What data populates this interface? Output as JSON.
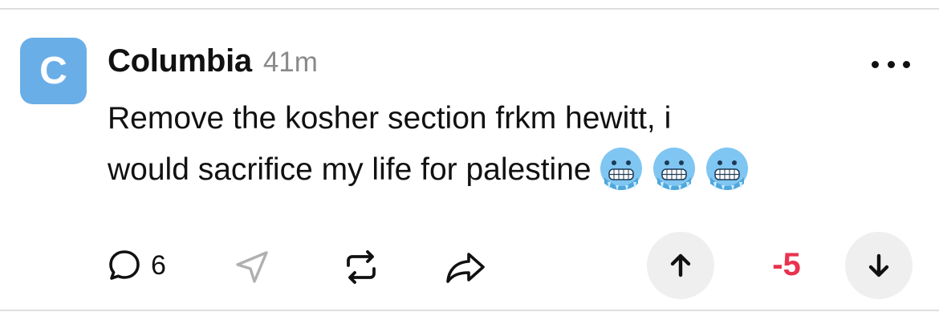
{
  "post": {
    "avatar_letter": "C",
    "author": "Columbia",
    "time": "41m",
    "body_line1": "Remove the kosher section frkm hewitt, i",
    "body_line2": "would sacrifice my life for palestine",
    "emojis": [
      "cold-face-emoji",
      "cold-face-emoji",
      "cold-face-emoji"
    ],
    "more_icon": "more-horizontal-icon"
  },
  "actions": {
    "comment_icon": "comment-bubble-icon",
    "comment_count": "6",
    "share_icon": "send-icon",
    "repost_icon": "repost-icon",
    "forward_icon": "forward-arrow-icon"
  },
  "votes": {
    "upvote_icon": "arrow-up-icon",
    "score": "-5",
    "downvote_icon": "arrow-down-icon"
  },
  "colors": {
    "avatar": "#6aaee8",
    "score": "#e8334f",
    "muted": "#8a8a8a",
    "vote_button_bg": "#efefef"
  }
}
